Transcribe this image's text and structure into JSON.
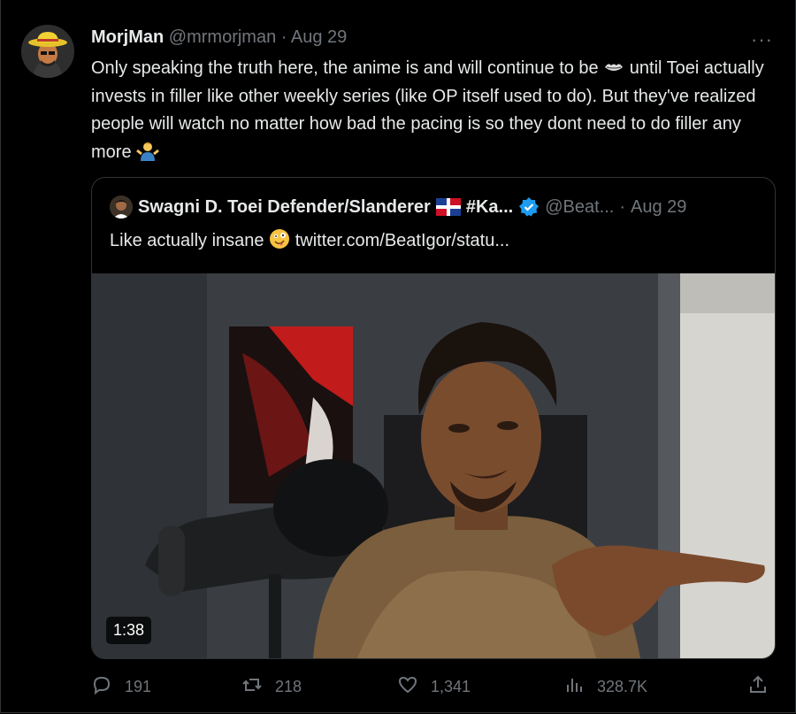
{
  "tweet": {
    "display_name": "MorjMan",
    "handle": "@mrmorjman",
    "separator": "·",
    "date": "Aug 29",
    "more_label": "···",
    "text_part1": "Only speaking the truth here, the anime is and will continue to be ",
    "text_part2": " until Toei actually invests in filler like other weekly series (like OP itself used to do). But they've realized people will watch no matter how bad the pacing is so they dont need to do filler any more ",
    "emoji_1": "lips-emoji",
    "emoji_2": "person-shrugging-emoji"
  },
  "quote": {
    "display_name": "Swagni D. Toei Defender/Slanderer",
    "hashtag": "#Ka...",
    "handle": "@Beat...",
    "separator": "·",
    "date": "Aug 29",
    "text": "Like actually insane",
    "link": "twitter.com/BeatIgor/statu...",
    "emoji": "zany-face-emoji",
    "flag": "dominican-republic-flag",
    "verified_color": "#1d9bf0",
    "video_duration": "1:38"
  },
  "actions": {
    "replies": "191",
    "retweets": "218",
    "likes": "1,341",
    "views": "328.7K"
  },
  "colors": {
    "background": "#000000",
    "text": "#e7e9ea",
    "muted": "#71767b",
    "border": "#2f3336",
    "accent": "#1d9bf0"
  }
}
